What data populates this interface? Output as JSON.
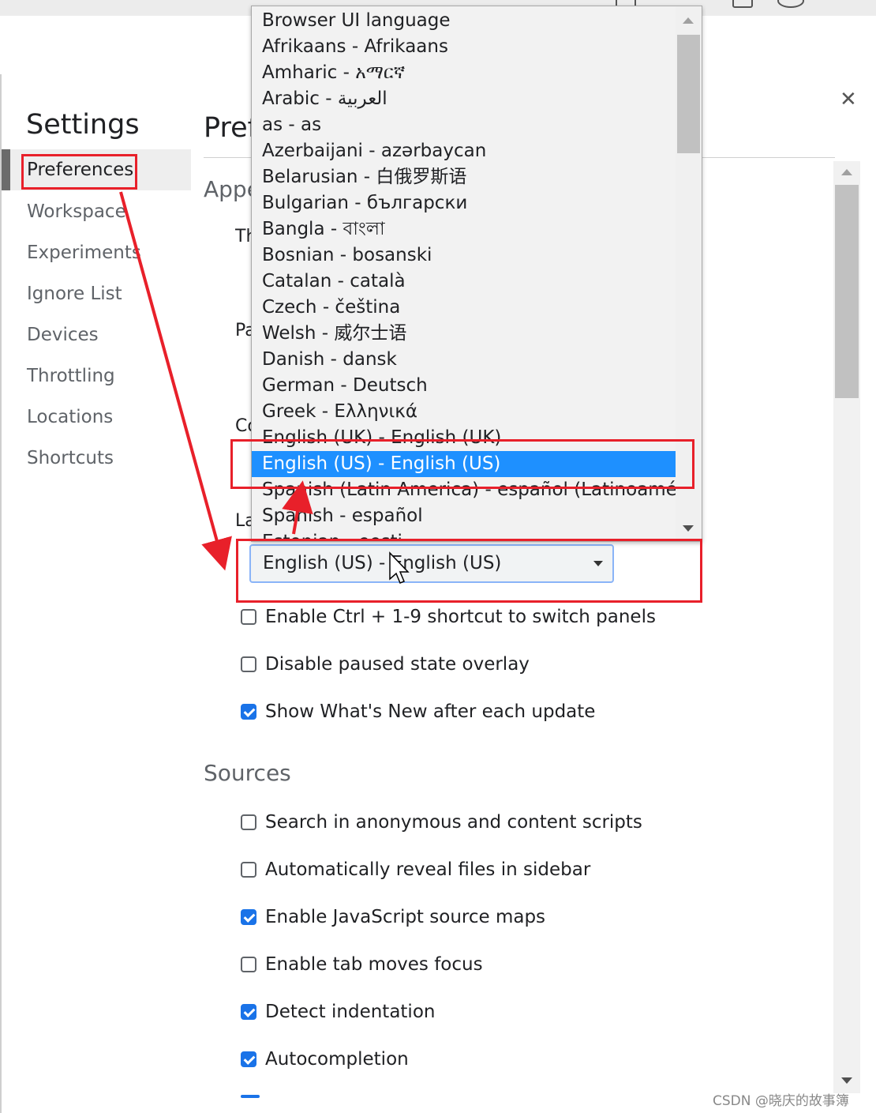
{
  "sidebar": {
    "title": "Settings",
    "items": [
      {
        "label": "Preferences"
      },
      {
        "label": "Workspace"
      },
      {
        "label": "Experiments"
      },
      {
        "label": "Ignore List"
      },
      {
        "label": "Devices"
      },
      {
        "label": "Throttling"
      },
      {
        "label": "Locations"
      },
      {
        "label": "Shortcuts"
      }
    ]
  },
  "main": {
    "title": "Preferences",
    "appearance_heading": "Appearance",
    "partial_labels": [
      "Th",
      "Pa",
      "Co",
      "La"
    ],
    "language_select": {
      "value": "English (US) - English (US)"
    },
    "appearance_options": [
      {
        "label": "Enable Ctrl + 1-9 shortcut to switch panels",
        "checked": false
      },
      {
        "label": "Disable paused state overlay",
        "checked": false
      },
      {
        "label": "Show What's New after each update",
        "checked": true
      }
    ],
    "sources_heading": "Sources",
    "sources_options": [
      {
        "label": "Search in anonymous and content scripts",
        "checked": false
      },
      {
        "label": "Automatically reveal files in sidebar",
        "checked": false
      },
      {
        "label": "Enable JavaScript source maps",
        "checked": true
      },
      {
        "label": "Enable tab moves focus",
        "checked": false
      },
      {
        "label": "Detect indentation",
        "checked": true
      },
      {
        "label": "Autocompletion",
        "checked": true
      }
    ]
  },
  "language_dropdown": {
    "selected": "English (US) - English (US)",
    "options": [
      "Browser UI language",
      "Afrikaans - Afrikaans",
      "Amharic - አማርኛ",
      "Arabic - العربية",
      "as - as",
      "Azerbaijani - azərbaycan",
      "Belarusian - 白俄罗斯语",
      "Bulgarian - български",
      "Bangla - বাংলা",
      "Bosnian - bosanski",
      "Catalan - català",
      "Czech - čeština",
      "Welsh - 威尔士语",
      "Danish - dansk",
      "German - Deutsch",
      "Greek - Ελληνικά",
      "English (UK) - English (UK)",
      "English (US) - English (US)",
      "Spanish (Latin America) - español (Latinoamérica)",
      "Spanish - español",
      "Estonian - eesti"
    ]
  },
  "watermark": "CSDN @晓庆的故事簿",
  "colors": {
    "accent": "#1a73e8",
    "dropdown_selected": "#1e90ff",
    "annotation_red": "#e8202a"
  },
  "icons": [
    "close-icon",
    "dropdown-caret-icon",
    "scroll-up-icon",
    "scroll-down-icon",
    "mouse-cursor-icon"
  ]
}
